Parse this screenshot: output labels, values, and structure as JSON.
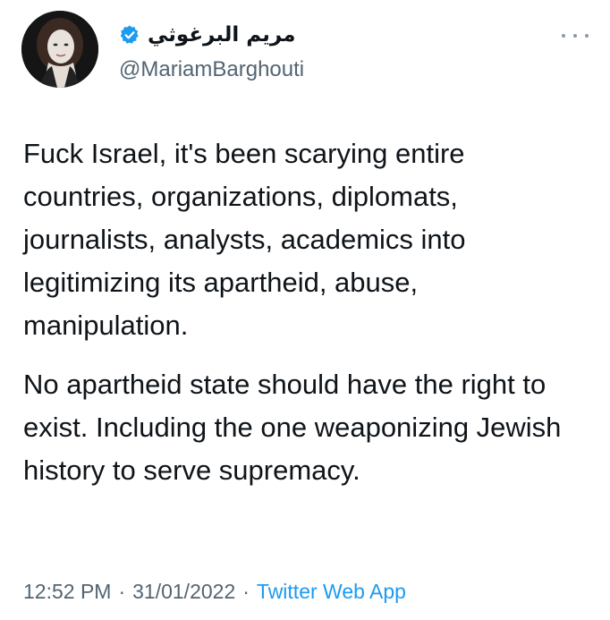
{
  "author": {
    "display_name": "مريم البرغوثي",
    "handle": "@MariamBarghouti",
    "verified": true,
    "avatar_icon": "profile-photo"
  },
  "header": {
    "more_icon": "more-options-icon"
  },
  "tweet": {
    "paragraphs": [
      "Fuck Israel, it's been scarying entire countries, organizations, diplomats, journalists, analysts, academics into legitimizing its apartheid, abuse, manipulation.",
      "No apartheid state should have the right to exist. Including the one weaponizing Jewish history to serve supremacy."
    ]
  },
  "meta": {
    "time": "12:52 PM",
    "date": "31/01/2022",
    "separator": "·",
    "source": "Twitter Web App"
  },
  "colors": {
    "text": "#0f1419",
    "secondary": "#536471",
    "accent": "#1d9bf0",
    "verified": "#1d9bf0"
  }
}
